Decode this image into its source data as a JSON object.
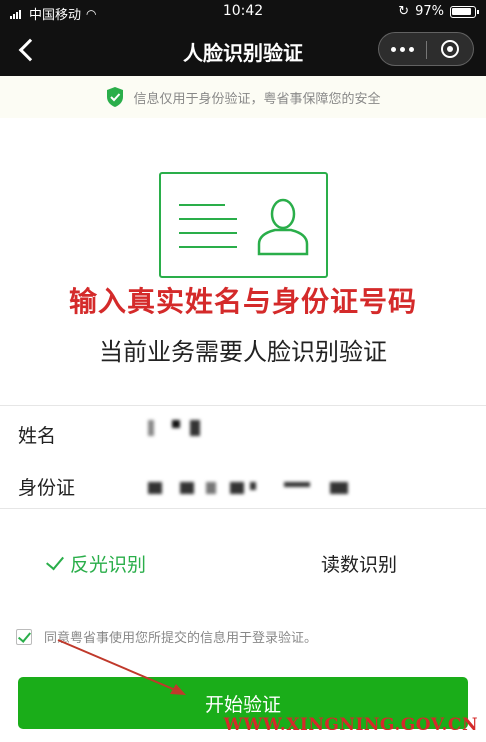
{
  "status_bar": {
    "carrier": "中国移动",
    "time": "10:42",
    "battery": "97%"
  },
  "nav": {
    "title": "人脸识别验证"
  },
  "banner": {
    "text": "信息仅用于身份验证，粤省事保障您的安全",
    "icon": "shield-check-icon",
    "icon_color": "#2aae4a"
  },
  "illustration": {
    "icon": "id-card-icon",
    "color": "#2aae4a"
  },
  "annotation": {
    "text": "输入真实姓名与身份证号码",
    "color": "#d42a2a"
  },
  "subtitle": "当前业务需要人脸识别验证",
  "form": {
    "name_label": "姓名",
    "id_label": "身份证"
  },
  "modes": {
    "reflect_label": "反光识别",
    "read_digits_label": "读数识别",
    "selected": "反光识别"
  },
  "agreement": {
    "checked": true,
    "text": "同意粤省事使用您所提交的信息用于登录验证。"
  },
  "primary_button": {
    "label": "开始验证",
    "color": "#1aad19"
  },
  "watermark": "WWW.XINGNING.GOV.CN"
}
